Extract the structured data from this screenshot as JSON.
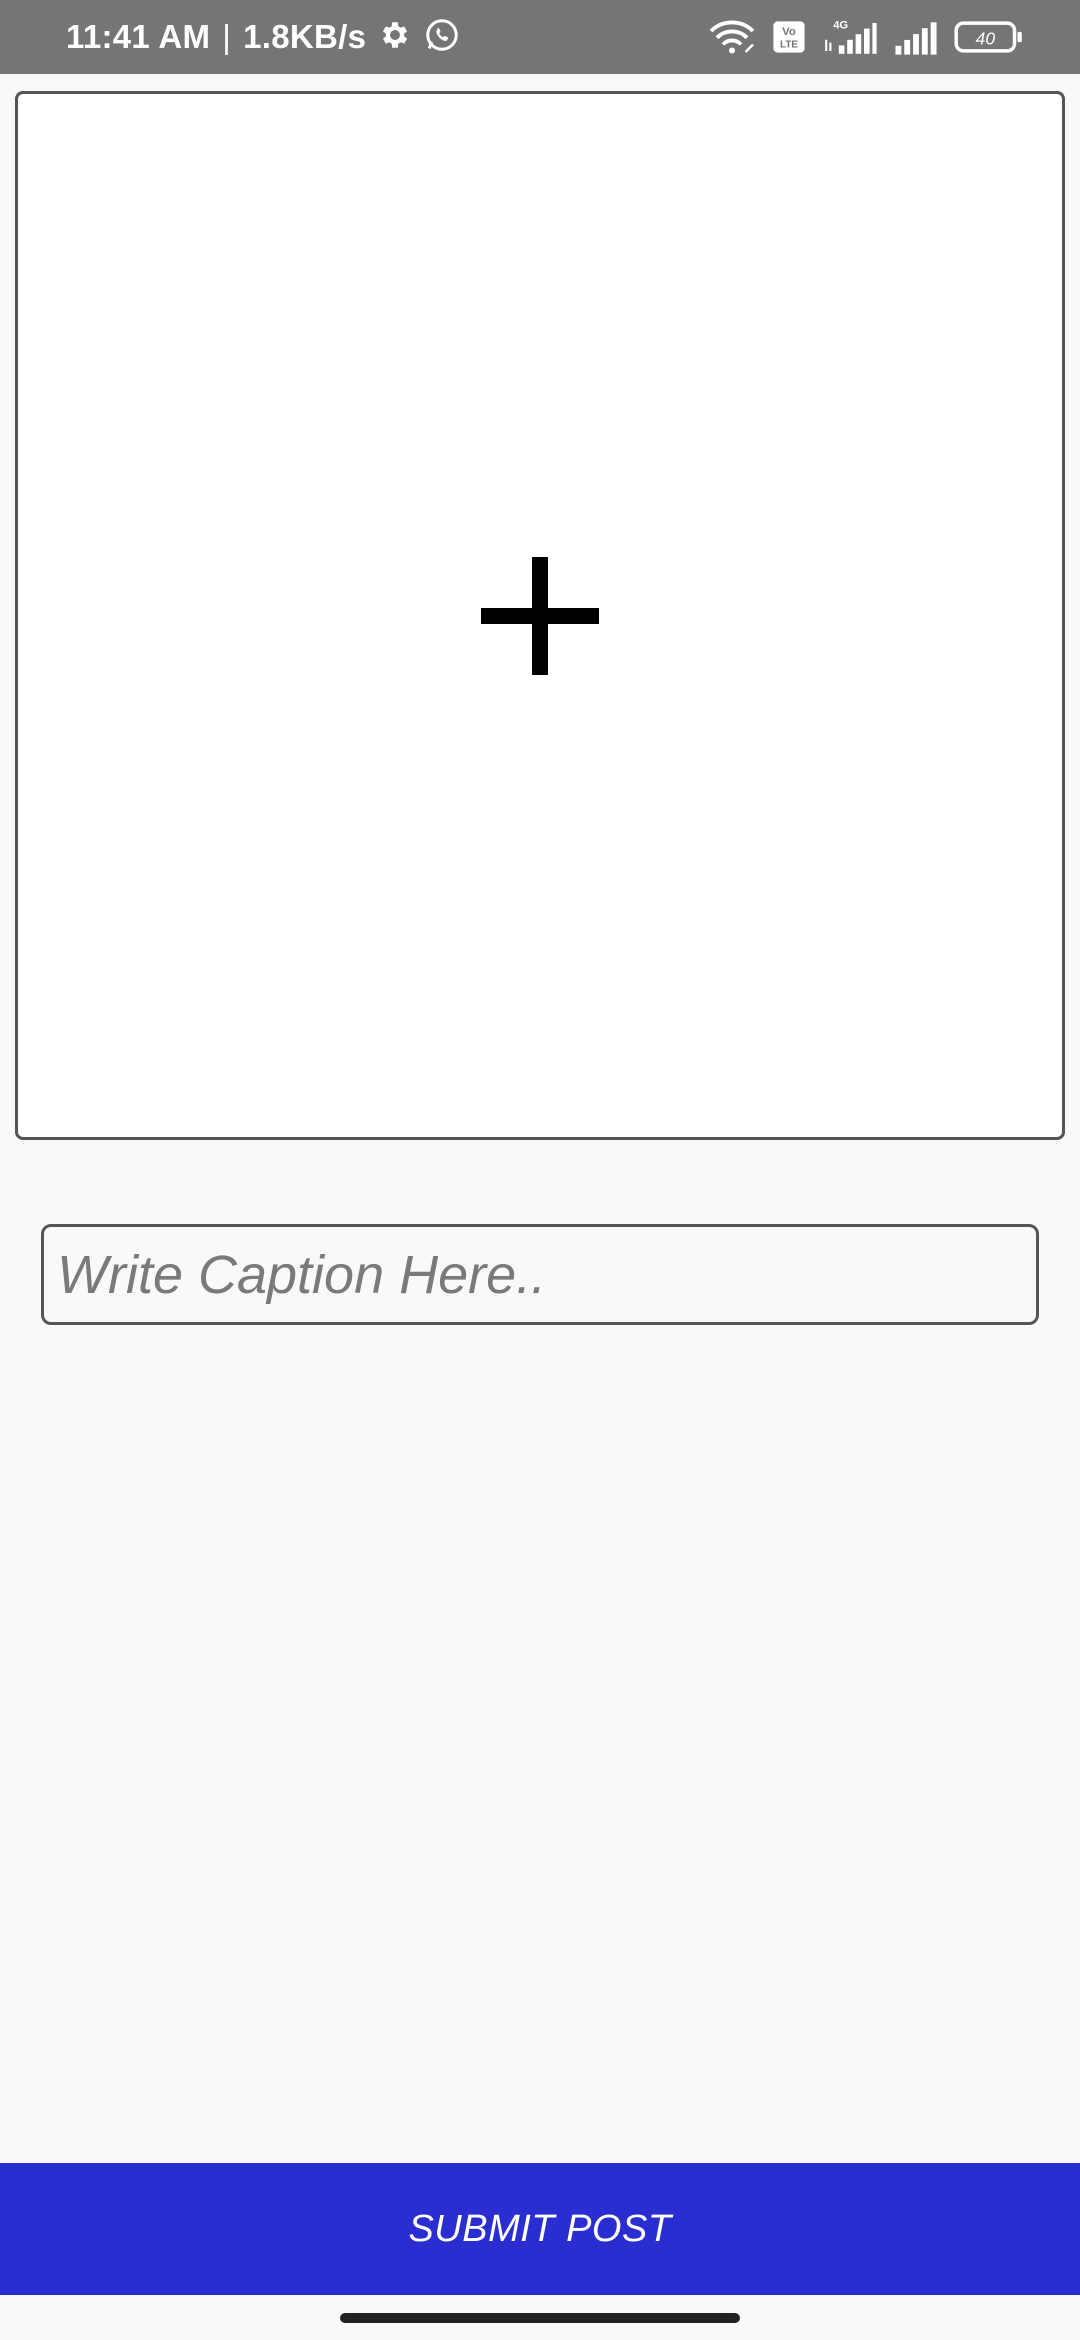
{
  "status_bar": {
    "time": "11:41 AM",
    "separator": "|",
    "network_speed": "1.8KB/s",
    "left_icons": [
      "gear-icon",
      "whatsapp-icon"
    ],
    "right_icons": [
      "wifi-icon",
      "volte-icon",
      "4g-signal-icon",
      "signal-icon",
      "battery-icon"
    ],
    "volte_label_top": "Vo",
    "volte_label_bottom": "LTE",
    "network_type": "4G",
    "battery_level": "40"
  },
  "image_picker": {
    "icon": "plus-icon"
  },
  "caption": {
    "placeholder": "Write Caption Here..",
    "value": ""
  },
  "submit": {
    "label": "SUBMIT POST",
    "color": "#2a2ed1"
  }
}
